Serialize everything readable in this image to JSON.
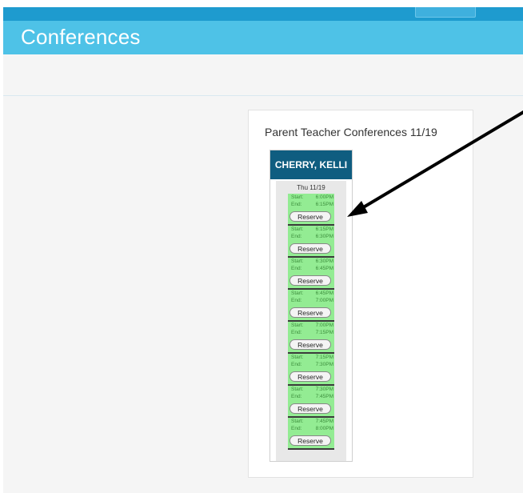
{
  "header": {
    "title": "Conferences"
  },
  "panel": {
    "title": "Parent Teacher Conferences 11/19"
  },
  "teacher": {
    "name": "CHERRY, KELLI"
  },
  "day": {
    "label": "Thu 11/19"
  },
  "slots": [
    {
      "start_label": "Start:",
      "start": "6:00PM",
      "end_label": "End:",
      "end": "6:15PM",
      "button": "Reserve"
    },
    {
      "start_label": "Start:",
      "start": "6:15PM",
      "end_label": "End:",
      "end": "6:30PM",
      "button": "Reserve"
    },
    {
      "start_label": "Start:",
      "start": "6:30PM",
      "end_label": "End:",
      "end": "6:45PM",
      "button": "Reserve"
    },
    {
      "start_label": "Start:",
      "start": "6:45PM",
      "end_label": "End:",
      "end": "7:00PM",
      "button": "Reserve"
    },
    {
      "start_label": "Start:",
      "start": "7:00PM",
      "end_label": "End:",
      "end": "7:15PM",
      "button": "Reserve"
    },
    {
      "start_label": "Start:",
      "start": "7:15PM",
      "end_label": "End:",
      "end": "7:30PM",
      "button": "Reserve"
    },
    {
      "start_label": "Start:",
      "start": "7:30PM",
      "end_label": "End:",
      "end": "7:45PM",
      "button": "Reserve"
    },
    {
      "start_label": "Start:",
      "start": "7:45PM",
      "end_label": "End:",
      "end": "8:00PM",
      "button": "Reserve"
    }
  ],
  "colors": {
    "topbar": "#1e9bcf",
    "header": "#4ec2e7",
    "teacher_header": "#0f5d80",
    "slot_available": "#93ec93"
  },
  "annotation": {
    "type": "arrow-icon"
  }
}
